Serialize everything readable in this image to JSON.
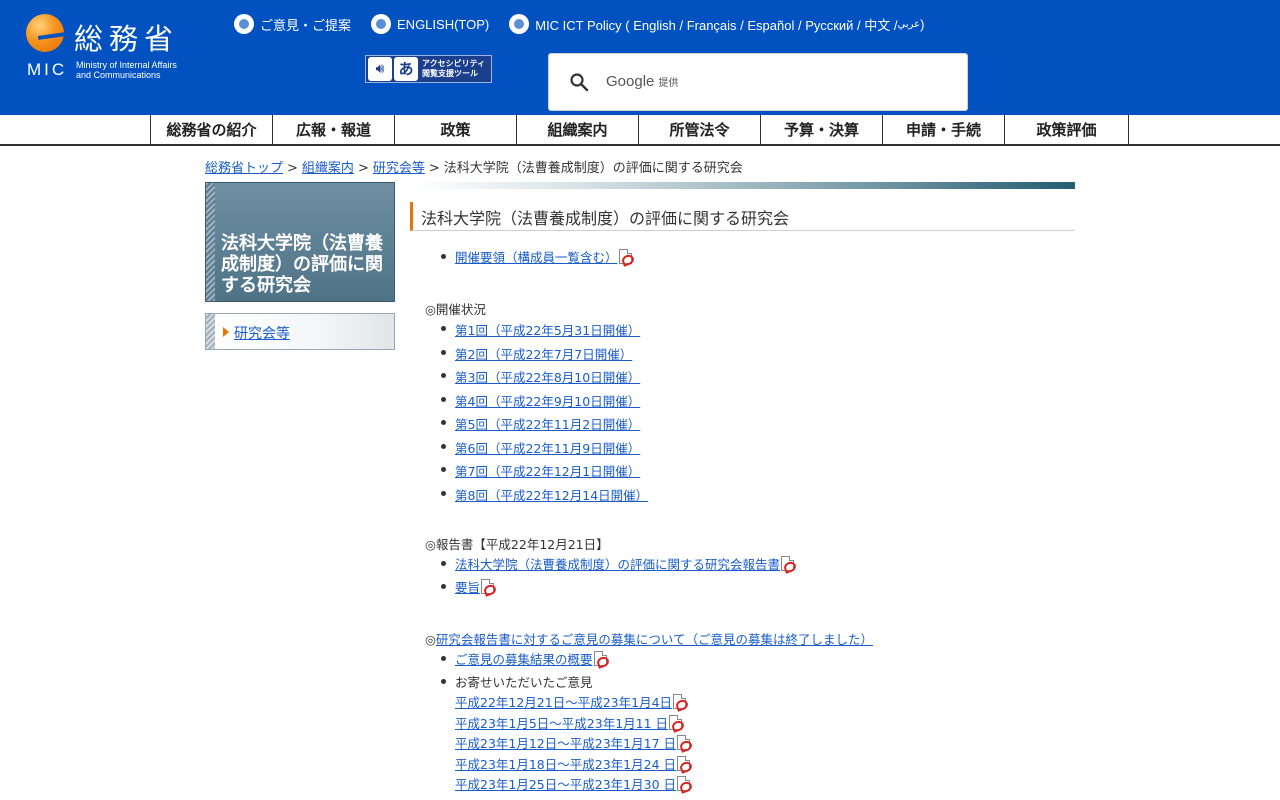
{
  "header": {
    "logo_kanji": "総務省",
    "logo_abbr": "MIC",
    "logo_full_1": "Ministry of Internal Affairs",
    "logo_full_2": "and Communications",
    "top_links": {
      "opinion": "ご意見・ご提案",
      "english": "ENGLISH(TOP)",
      "ict_policy_prefix": "MIC ICT Policy ( English / Français / Español / Русский / 中文 / ",
      "ict_policy_arabic": "عربي",
      "ict_policy_suffix": " )"
    },
    "accessibility_tool_line1": "アクセシビリティ",
    "accessibility_tool_line2": "閲覧支援ツール",
    "accessibility_tool_char": "あ",
    "search": {
      "brand": "Google",
      "provided": "提供"
    }
  },
  "gnav": {
    "items": [
      "総務省の紹介",
      "広報・報道",
      "政策",
      "組織案内",
      "所管法令",
      "予算・決算",
      "申請・手続",
      "政策評価"
    ]
  },
  "breadcrumb": {
    "top": "総務省トップ",
    "org": "組織案内",
    "study": "研究会等",
    "current": "法科大学院（法曹養成制度）の評価に関する研究会",
    "separator": ">"
  },
  "sidebar": {
    "title": "法科大学院（法曹養成制度）の評価に関する研究会",
    "nav_link": "研究会等"
  },
  "main": {
    "title": "法科大学院（法曹養成制度）の評価に関する研究会",
    "outline_link": "開催要領（構成員一覧含む）",
    "meetings_heading": "◎開催状況",
    "meetings": [
      "第1回（平成22年5月31日開催）",
      "第2回（平成22年7月7日開催）",
      "第3回（平成22年8月10日開催）",
      "第4回（平成22年9月10日開催）",
      "第5回（平成22年11月2日開催）",
      "第6回（平成22年11月9日開催）",
      "第7回（平成22年12月1日開催）",
      "第8回（平成22年12月14日開催）"
    ],
    "report_heading": "◎報告書【平成22年12月21日】",
    "report_links": [
      "法科大学院（法曹養成制度）の評価に関する研究会報告書",
      "要旨"
    ],
    "opinion_heading_prefix": "◎",
    "opinion_heading_link": "研究会報告書に対するご意見の募集について（ご意見の募集は終了しました）",
    "opinion_summary_link": "ご意見の募集結果の概要",
    "opinion_received_label": "お寄せいただいたご意見",
    "opinion_periods": [
      "平成22年12月21日～平成23年1月4日",
      "平成23年1月5日～平成23年1月11 日",
      "平成23年1月12日～平成23年1月17 日",
      "平成23年1月18日～平成23年1月24 日",
      "平成23年1月25日～平成23年1月30 日"
    ]
  },
  "colors": {
    "header_bg": "#0152c0",
    "accent_orange": "#e8740c",
    "link": "#1a5dc8",
    "sidebar_title_bg": "#5a7d90"
  }
}
